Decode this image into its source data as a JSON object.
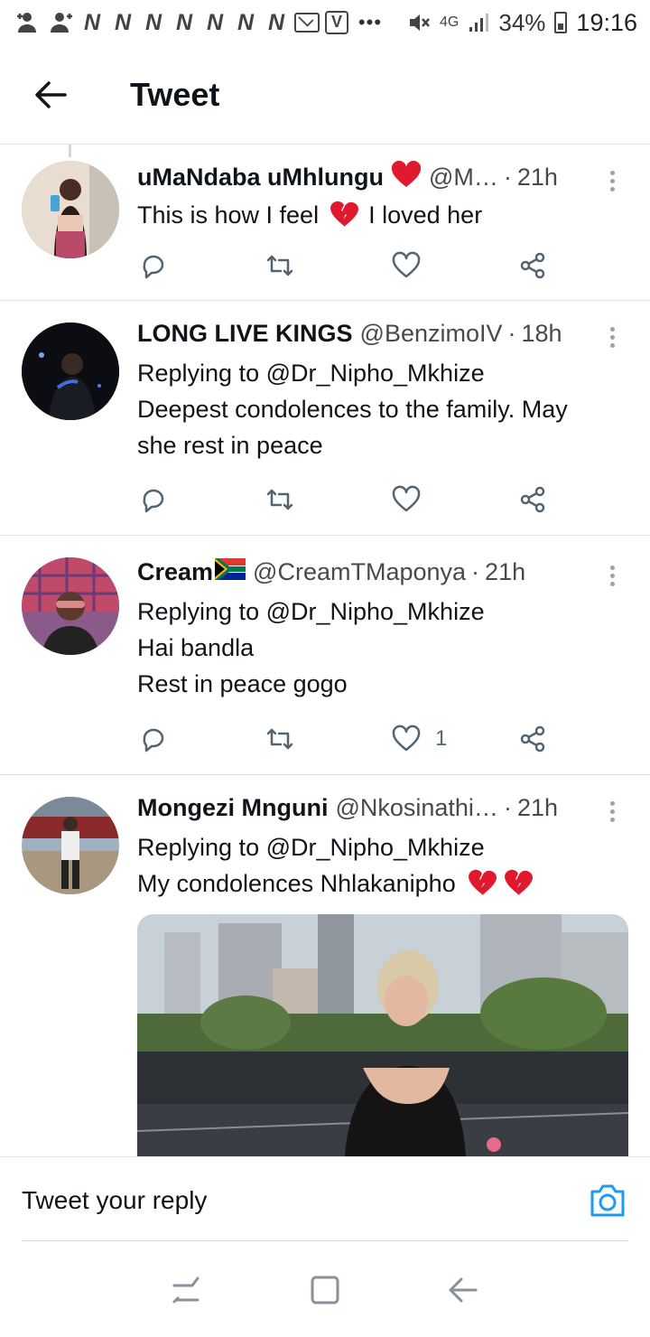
{
  "status_bar": {
    "notification_icons": [
      "add-person-icon",
      "add-person-icon",
      "n-icon",
      "n-icon",
      "n-icon",
      "n-icon",
      "n-icon",
      "n-icon",
      "n-icon",
      "mail-icon",
      "v-icon"
    ],
    "more": "•••",
    "network": "4G",
    "battery": "34%",
    "time": "19:16"
  },
  "header": {
    "title": "Tweet"
  },
  "tweets": [
    {
      "name": "uMaNdaba uMhlungu",
      "name_emoji": "red-heart",
      "handle": "@M…",
      "time": "21h",
      "replying": "",
      "text_lines": [
        "This is how I feel",
        "I loved her"
      ],
      "likes": ""
    },
    {
      "name": "LONG LIVE KINGS",
      "handle": "@BenzimoIV",
      "time": "18h",
      "replying": "Replying to @Dr_Nipho_Mkhize",
      "text_lines": [
        "Deepest condolences to the family. May",
        "she rest in peace"
      ],
      "likes": ""
    },
    {
      "name": "Cream",
      "name_emoji": "south-africa-flag",
      "handle": "@CreamTMaponya",
      "time": "21h",
      "replying": "Replying to @Dr_Nipho_Mkhize",
      "text_lines": [
        "Hai bandla",
        "Rest in peace gogo"
      ],
      "likes": "1"
    },
    {
      "name": "Mongezi Mnguni",
      "handle": "@Nkosinathi…",
      "time": "21h",
      "replying": "Replying to @Dr_Nipho_Mkhize",
      "text_lines": [
        "My condolences Nhlakanipho"
      ],
      "likes": ""
    }
  ],
  "reply_bar": {
    "placeholder": "Tweet your reply"
  },
  "colors": {
    "accent": "#1d9bf0",
    "text": "#0f1419",
    "secondary": "#454a4f",
    "divider": "#e1e5e8",
    "heart": "#e0245e"
  }
}
